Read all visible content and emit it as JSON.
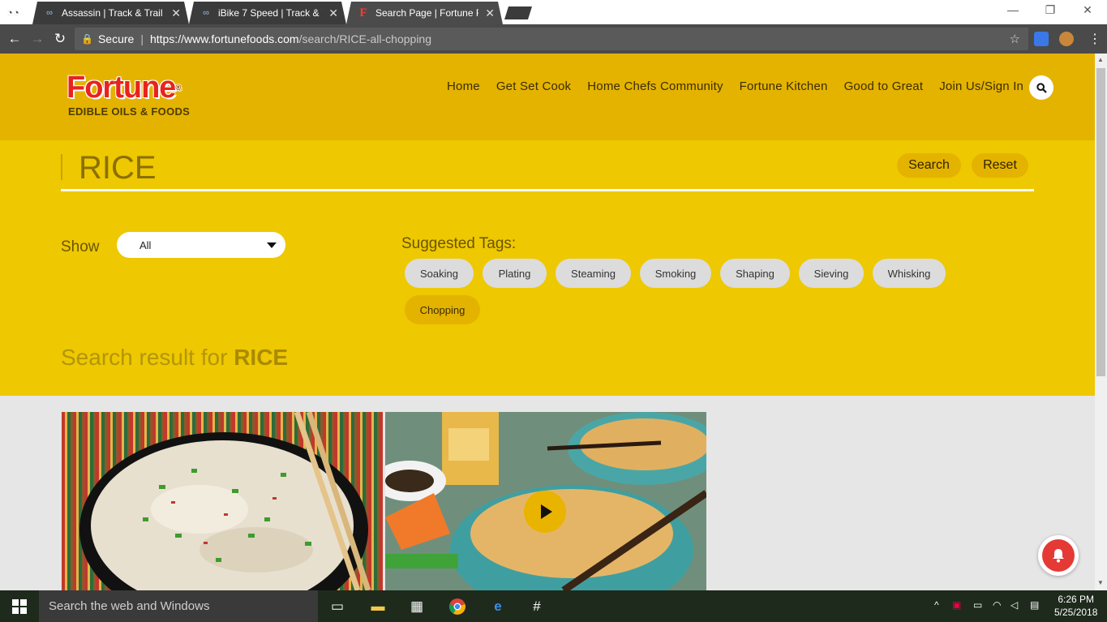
{
  "browser": {
    "tabs": [
      {
        "title": "Assassin | Track & Trail",
        "active": false
      },
      {
        "title": "iBike 7 Speed | Track & Tr",
        "active": false
      },
      {
        "title": "Search Page | Fortune Foo",
        "active": true
      }
    ],
    "secure_label": "Secure",
    "url_host": "https://www.fortunefoods.com",
    "url_path": "/search/RICE-all-chopping"
  },
  "site": {
    "logo_word": "Fortune",
    "logo_reg": "®",
    "logo_tagline": "EDIBLE OILS & FOODS",
    "nav": [
      "Home",
      "Get Set Cook",
      "Home Chefs Community",
      "Fortune Kitchen",
      "Good to Great",
      "Join Us/Sign In"
    ]
  },
  "search": {
    "query": "RICE",
    "search_label": "Search",
    "reset_label": "Reset",
    "show_label": "Show",
    "show_value": "All",
    "tags_title": "Suggested Tags:",
    "tags": [
      "Soaking",
      "Plating",
      "Steaming",
      "Smoking",
      "Shaping",
      "Sieving",
      "Whisking",
      "Chopping"
    ],
    "active_tag": "Chopping",
    "result_prefix": "Search result for",
    "result_term": "RICE"
  },
  "taskbar": {
    "search_placeholder": "Search the web and Windows",
    "time": "6:26 PM",
    "date": "5/25/2018"
  },
  "colors": {
    "header": "#e4b300",
    "panel": "#eec800",
    "brand_red": "#e8231f"
  }
}
